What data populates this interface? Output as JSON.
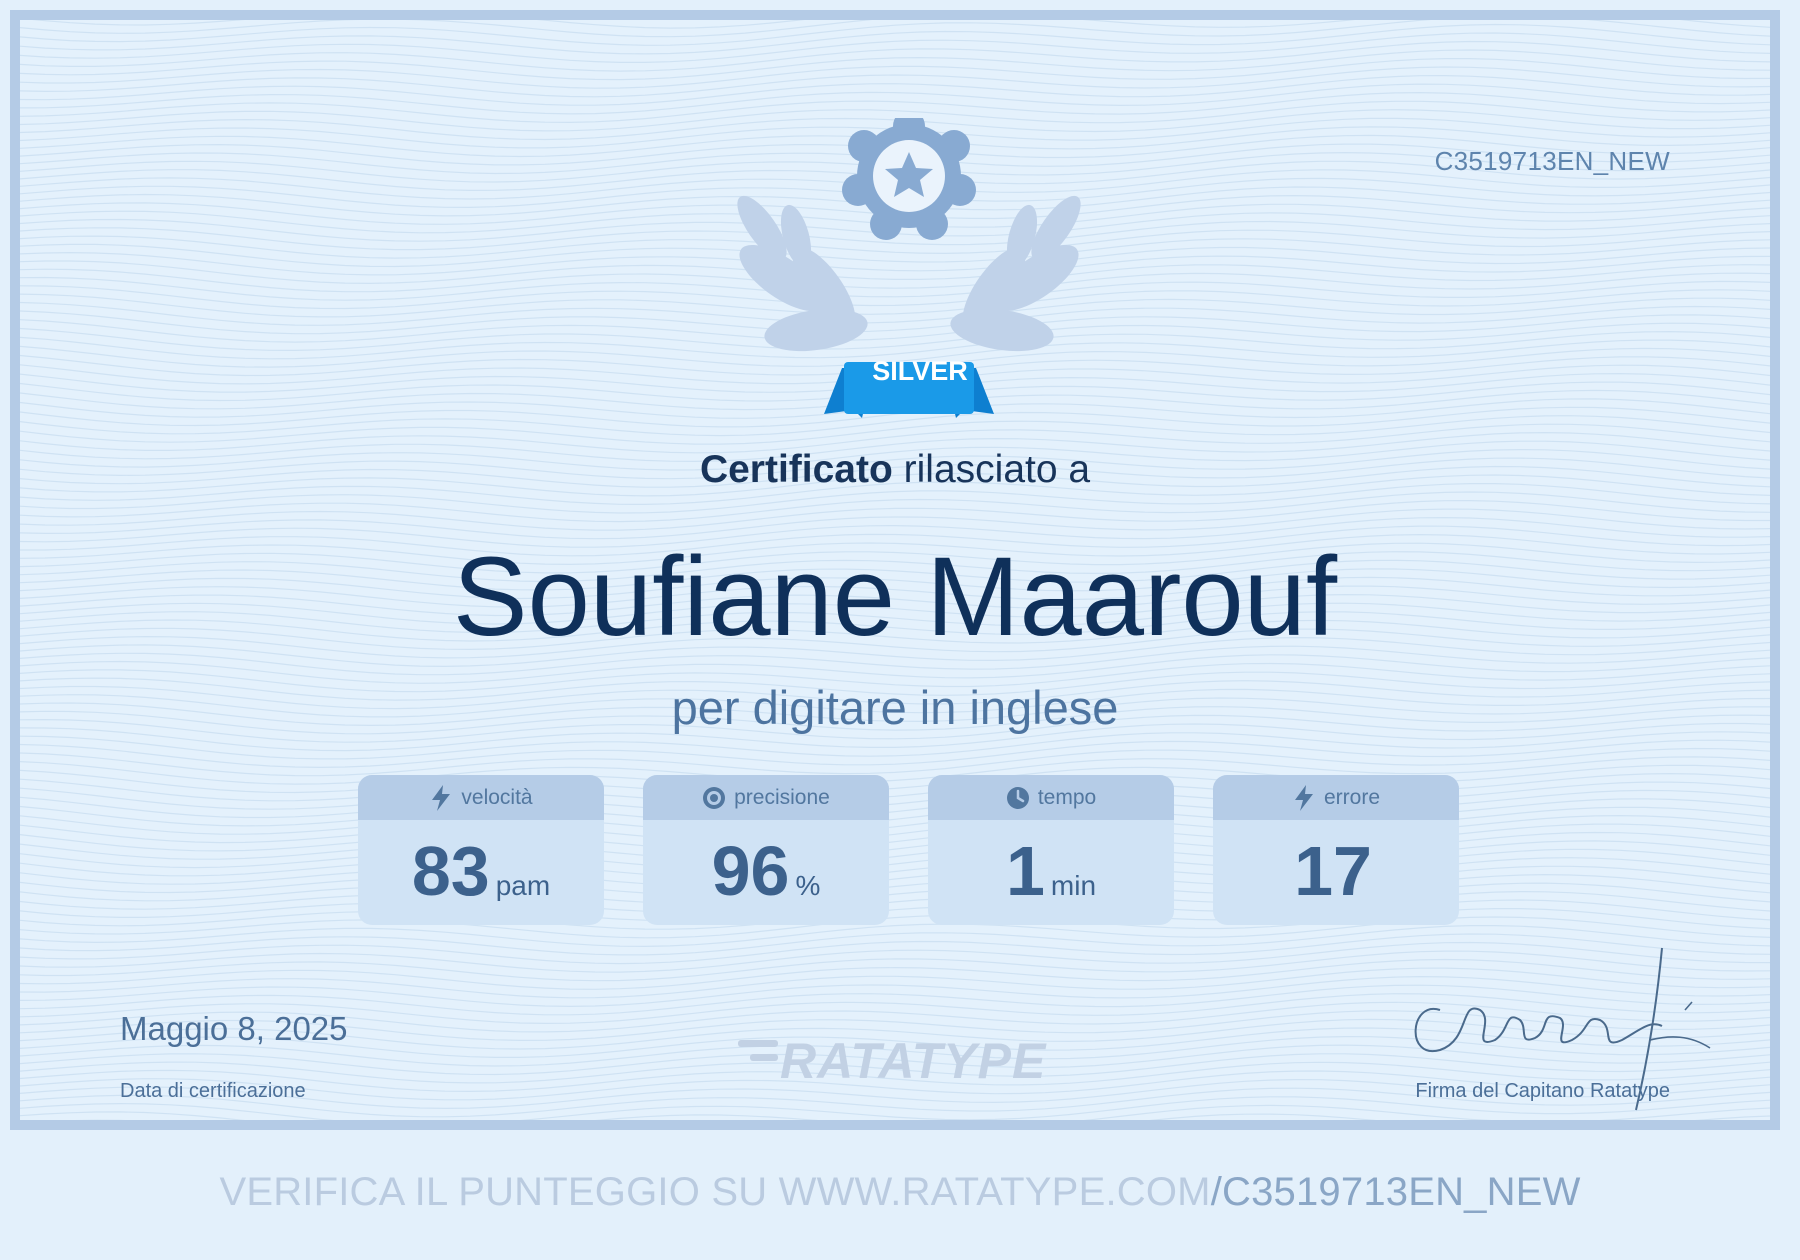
{
  "certificate": {
    "id": "C3519713EN_NEW",
    "level_badge": "SILVER",
    "issued_bold": "Certificato",
    "issued_rest": " rilasciato a",
    "recipient_name": "Soufiane Maarouf",
    "purpose": "per digitare in inglese"
  },
  "stats": [
    {
      "label": "velocità",
      "value": "83",
      "unit": "pam",
      "icon": "lightning-icon"
    },
    {
      "label": "precisione",
      "value": "96",
      "unit": "%",
      "icon": "target-icon"
    },
    {
      "label": "tempo",
      "value": "1",
      "unit": "min",
      "icon": "clock-icon"
    },
    {
      "label": "errore",
      "value": "17",
      "unit": "",
      "icon": "lightning-icon"
    }
  ],
  "footer": {
    "date": "Maggio 8, 2025",
    "date_label": "Data di certificazione",
    "logo": "RATATYPE",
    "signature_label": "Firma del Capitano Ratatype"
  },
  "verify": {
    "prefix": "VERIFICA IL PUNTEGGIO SU WWW.RATATYPE.COM",
    "code": "/C3519713EN_NEW"
  },
  "colors": {
    "border": "#b4cbe6",
    "name": "#0f305a",
    "badge": "#1a9ae8",
    "emblem": "#88aad2",
    "stat_card": "#d0e3f5",
    "stat_header": "#b5cce7"
  }
}
